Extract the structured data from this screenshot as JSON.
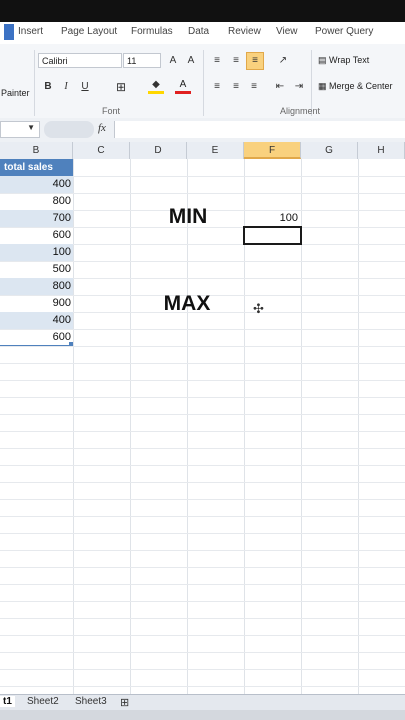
{
  "ribbon_tabs": [
    "Insert",
    "Page Layout",
    "Formulas",
    "Data",
    "Review",
    "View",
    "Power Query"
  ],
  "clipboard": {
    "painter_label": "Painter"
  },
  "font": {
    "name": "Calibri",
    "size": "11",
    "group_label": "Font",
    "bold": "B",
    "italic": "I",
    "underline": "U"
  },
  "alignment": {
    "wrap_text": "Wrap Text",
    "merge_center": "Merge & Center",
    "group_label": "Alignment"
  },
  "formula_bar": {
    "fx": "fx"
  },
  "columns": [
    "B",
    "C",
    "D",
    "E",
    "F",
    "G",
    "H"
  ],
  "active_column": "F",
  "header_cell": "total sales",
  "sales_values": [
    "400",
    "800",
    "700",
    "600",
    "100",
    "500",
    "800",
    "900",
    "400",
    "600"
  ],
  "labels": {
    "min": "MIN",
    "max": "MAX"
  },
  "min_result": "100",
  "sheets": [
    "t1",
    "Sheet2",
    "Sheet3"
  ],
  "colors": {
    "header_fill": "#4f81bd",
    "band_fill": "#dce6f1",
    "active_col": "#f9d17e",
    "selection_border": "#1a1a1a"
  }
}
